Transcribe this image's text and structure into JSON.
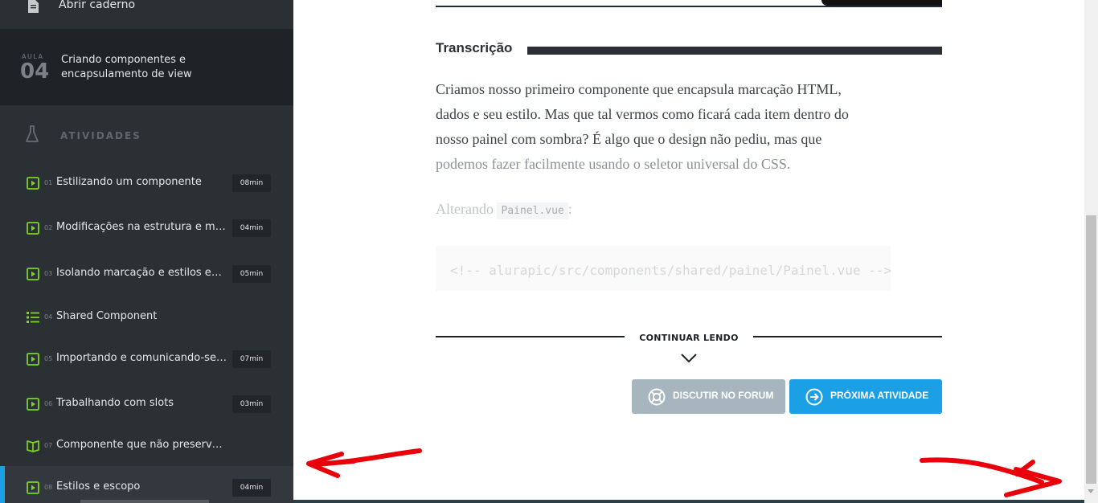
{
  "sidebar": {
    "notebook_label": "Abrir caderno",
    "lesson": {
      "aula_label": "AULA",
      "number": "04",
      "title": "Criando componentes e encapsulamento de view"
    },
    "activities_label": "ATIVIDADES",
    "activities": [
      {
        "index": "01",
        "title": "Estilizando um componente",
        "duration": "08min",
        "icon": "video-icon"
      },
      {
        "index": "02",
        "title": "Modificações na estrutura e mais ...",
        "duration": "04min",
        "icon": "video-icon"
      },
      {
        "index": "03",
        "title": "Isolando marcação e estilos em u...",
        "duration": "05min",
        "icon": "video-icon"
      },
      {
        "index": "04",
        "title": "Shared Component",
        "duration": "",
        "icon": "list-icon"
      },
      {
        "index": "05",
        "title": "Importando e comunicando-se co...",
        "duration": "07min",
        "icon": "video-icon"
      },
      {
        "index": "06",
        "title": "Trabalhando com slots",
        "duration": "03min",
        "icon": "video-icon"
      },
      {
        "index": "07",
        "title": "Componente que não preserva seu co...",
        "duration": "",
        "icon": "book-icon"
      },
      {
        "index": "08",
        "title": "Estilos e escopo",
        "duration": "04min",
        "icon": "video-icon",
        "active": true
      }
    ]
  },
  "main": {
    "transcript_heading": "Transcrição",
    "paragraph_lines": [
      "Criamos nosso primeiro componente que encapsula marcação HTML,",
      "dados e seu estilo. Mas que tal vermos como ficará cada item dentro do",
      "nosso painel com sombra? É algo que o design não pediu, mas que",
      "podemos fazer facilmente usando o seletor universal do CSS."
    ],
    "alterando_prefix": "Alterando",
    "alterando_code": "Painel.vue",
    "alterando_suffix": ":",
    "code_line": "<!-- alurapic/src/components/shared/painel/Painel.vue -->",
    "continue_label": "CONTINUAR LENDO",
    "forum_button": "DISCUTIR NO FORUM",
    "next_button": "PRÓXIMA ATIVIDADE"
  },
  "colors": {
    "sidebar_bg": "#2b3035",
    "accent_green": "#7ed321",
    "accent_blue": "#1b9fe5",
    "annotation_red": "#e8000b"
  }
}
